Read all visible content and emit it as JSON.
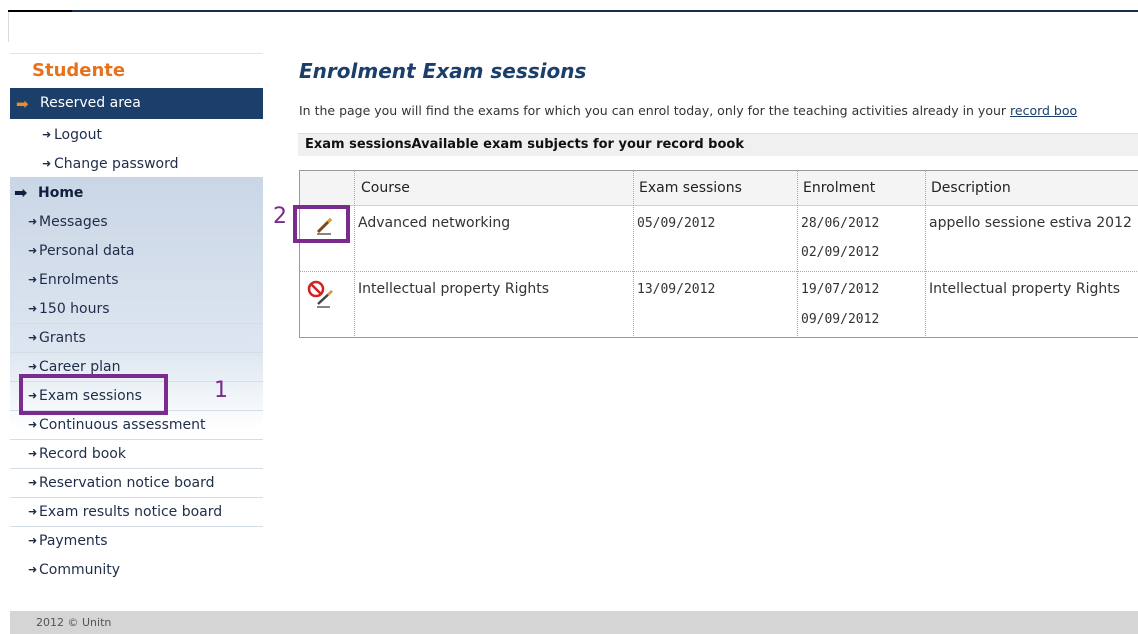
{
  "sidebar": {
    "title": "Studente",
    "reserved": "Reserved area",
    "logout": "Logout",
    "change_password": "Change password",
    "home": "Home",
    "items": [
      "Messages",
      "Personal data",
      "Enrolments",
      "150 hours",
      "Grants",
      "Career plan",
      "Exam sessions",
      "Continuous assessment",
      "Record book",
      "Reservation notice board",
      "Exam results notice board",
      "Payments",
      "Community"
    ]
  },
  "annotations": {
    "marker1": "1",
    "marker2": "2"
  },
  "main": {
    "title": "Enrolment Exam sessions",
    "intro_text": "In the page you will find the exams for which you can enrol today, only for the teaching activities already in your ",
    "intro_link": "record boo",
    "subheading": "Exam sessionsAvailable exam subjects for your record book",
    "columns": [
      "Course",
      "Exam sessions",
      "Enrolment",
      "Description"
    ],
    "rows": [
      {
        "course": "Advanced networking",
        "exam_session": "05/09/2012",
        "enrol_from": "28/06/2012",
        "enrol_to": "02/09/2012",
        "description": "appello sessione estiva 2012",
        "action_icon": "pencil-icon"
      },
      {
        "course": "Intellectual property Rights",
        "exam_session": "13/09/2012",
        "enrol_from": "19/07/2012",
        "enrol_to": "09/09/2012",
        "description": "Intellectual property Rights",
        "action_icon": "no-enrol-icon"
      }
    ]
  },
  "footer": {
    "text": "2012 © Unitn"
  },
  "colors": {
    "accent_orange": "#e8721c",
    "navy": "#1b3f6a",
    "highlight": "#7b2a8f"
  }
}
